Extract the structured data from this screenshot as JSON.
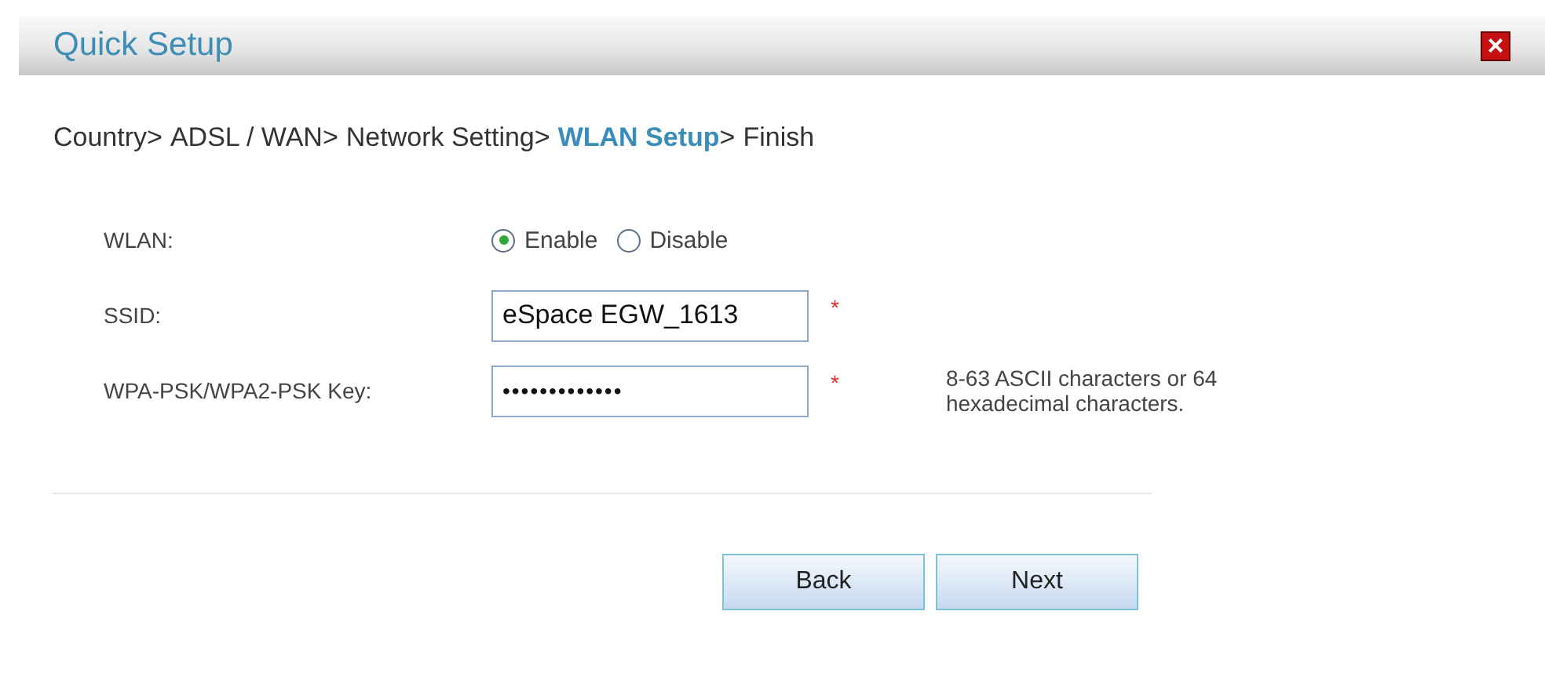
{
  "dialog": {
    "title": "Quick Setup",
    "close": "×"
  },
  "breadcrumb": [
    {
      "label": "Country",
      "selected": false
    },
    {
      "label": "ADSL / WAN",
      "selected": false
    },
    {
      "label": "Network Setting",
      "selected": false
    },
    {
      "label": "WLAN Setup",
      "selected": true
    },
    {
      "label": "Finish",
      "selected": false
    }
  ],
  "breadcrumb_separator": ">",
  "fields": [
    {
      "kind": "radio",
      "label": "WLAN:",
      "options": [
        {
          "label": "Enable",
          "selected": true
        },
        {
          "label": "Disable",
          "selected": false
        }
      ]
    },
    {
      "kind": "text",
      "label": "SSID:",
      "value": "eSpace EGW_1613",
      "required_mark": "*"
    },
    {
      "kind": "password",
      "label": "WPA-PSK/WPA2-PSK Key:",
      "value": "•••••••••••••",
      "required_mark": "*",
      "hint": "8-63 ASCII characters or 64 hexadecimal characters."
    }
  ],
  "buttons": [
    "Back",
    "Next"
  ]
}
